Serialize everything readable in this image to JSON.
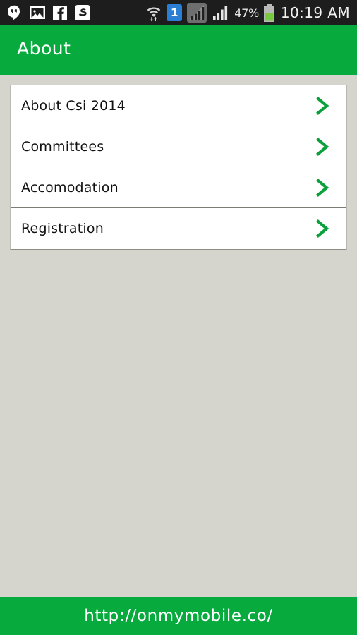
{
  "status_bar": {
    "background_color": "#1d1d1d",
    "notification_icons": [
      {
        "name": "hangouts-icon",
        "label": "Hangouts"
      },
      {
        "name": "gallery-icon",
        "label": "Gallery"
      },
      {
        "name": "facebook-icon",
        "label": "Facebook"
      },
      {
        "name": "app-icon",
        "label": "App"
      }
    ],
    "wifi_icon": "wifi-icon",
    "message_badge": "1",
    "sim1_signal_icon": "signal-sim1-icon",
    "sim2_signal_icon": "signal-sim2-icon",
    "battery_percent": "47%",
    "battery_icon": "battery-icon",
    "clock": "10:19 AM"
  },
  "header": {
    "title": "About",
    "background_color": "#07aa3c",
    "text_color": "#ffffff"
  },
  "content": {
    "background_color": "#d5d5cd",
    "menu": {
      "chevron_color": "#0aa13c",
      "items": [
        {
          "label": "About Csi 2014",
          "icon": "chevron-right-icon"
        },
        {
          "label": "Committees",
          "icon": "chevron-right-icon"
        },
        {
          "label": "Accomodation",
          "icon": "chevron-right-icon"
        },
        {
          "label": "Registration",
          "icon": "chevron-right-icon"
        }
      ]
    }
  },
  "footer": {
    "url": "http://onmymobile.co/",
    "background_color": "#07aa3c",
    "text_color": "#ffffff"
  }
}
